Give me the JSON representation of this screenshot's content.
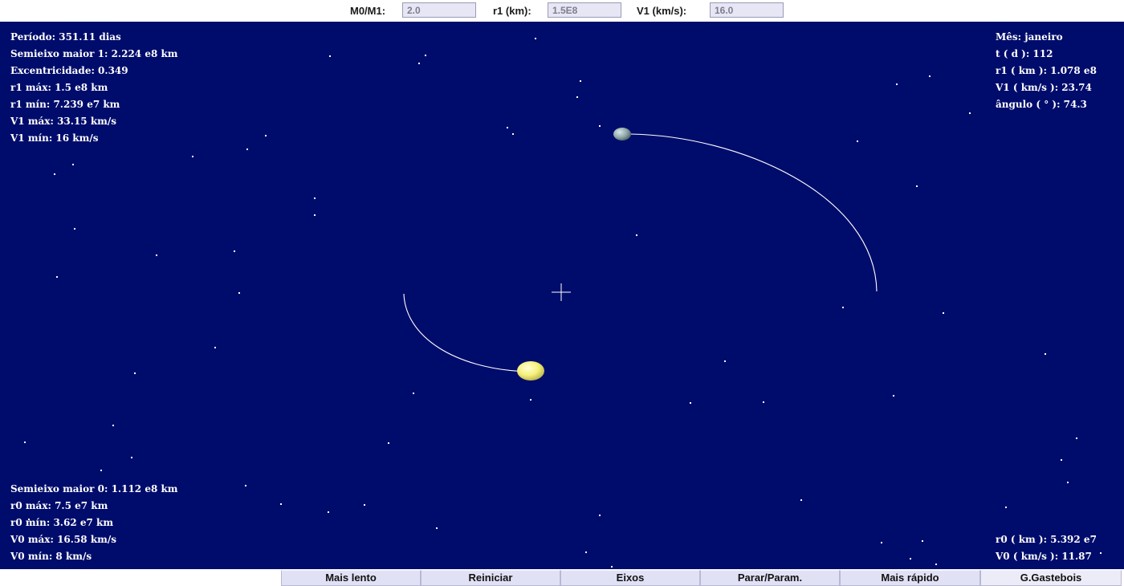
{
  "params": {
    "mass_ratio": {
      "label": "M0/M1:",
      "value": "2.0"
    },
    "r1": {
      "label": "r1 (km):",
      "value": "1.5E8"
    },
    "v1": {
      "label": "V1 (km/s):",
      "value": "16.0"
    }
  },
  "info_top_left": [
    "Período: 351.11 dias",
    "Semieixo maior 1: 2.224 e8 km",
    "Excentricidade: 0.349",
    "r1 máx: 1.5 e8 km",
    "r1 mín: 7.239 e7 km",
    "V1 máx: 33.15 km/s",
    "V1 mín: 16 km/s"
  ],
  "info_top_right": [
    "Mês: janeiro",
    "t ( d ): 112",
    "r1 ( km ): 1.078 e8",
    "V1 ( km/s ): 23.74",
    "ângulo ( ° ): 74.3"
  ],
  "info_bottom_left": [
    "Semieixo maior 0: 1.112 e8 km",
    "r0 máx: 7.5 e7 km",
    "r0 mín: 3.62 e7 km",
    "V0 máx: 16.58 km/s",
    "V0 mín: 8 km/s"
  ],
  "info_bottom_right": [
    "r0 ( km ): 5.392 e7",
    "V0 ( km/s ): 11.87"
  ],
  "buttons": {
    "slower": "Mais lento",
    "restart": "Reiniciar",
    "axes": "Eixos",
    "stop": "Parar/Param.",
    "faster": "Mais rápido",
    "credit": "G.Gastebois"
  },
  "colors": {
    "space": "#000c6b",
    "star0": "#f5f07a",
    "star1": "#8fa6a8",
    "orbit": "#ffffff"
  }
}
